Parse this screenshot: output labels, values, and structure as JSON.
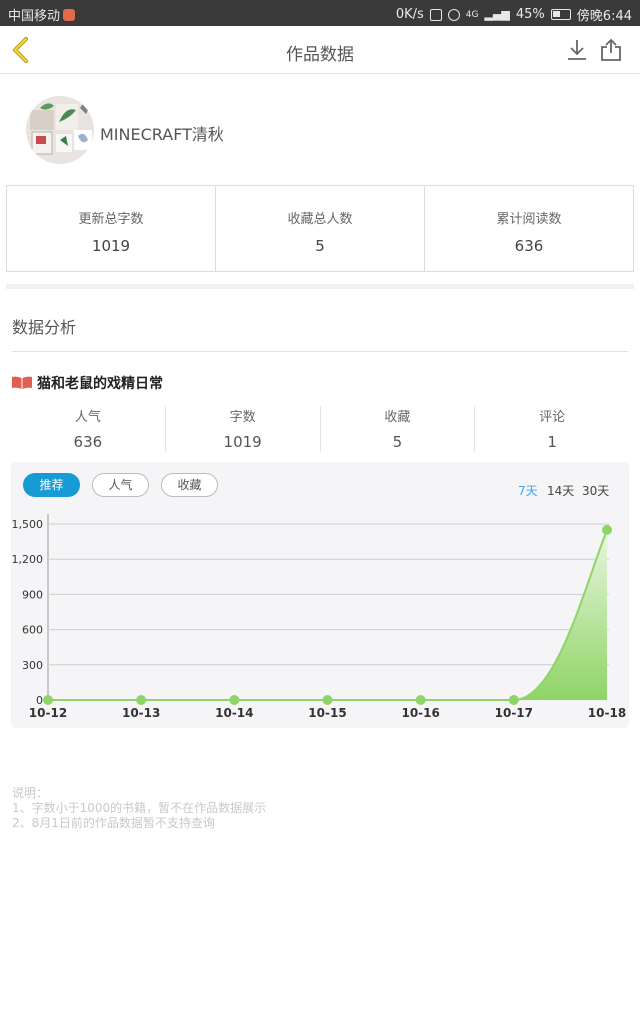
{
  "status_bar": {
    "carrier": "中国移动",
    "speed": "0K/s",
    "network": "4G",
    "battery": "45%",
    "time": "傍晚6:44"
  },
  "header": {
    "title": "作品数据",
    "back_icon": "chevron-left-icon",
    "download_icon": "download-icon",
    "share_icon": "share-icon"
  },
  "profile": {
    "username": "MINECRAFT清秋"
  },
  "summary": [
    {
      "label": "更新总字数",
      "value": "1019"
    },
    {
      "label": "收藏总人数",
      "value": "5"
    },
    {
      "label": "累计阅读数",
      "value": "636"
    }
  ],
  "analysis": {
    "section_title": "数据分析",
    "book_title": "猫和老鼠的戏精日常",
    "stats": [
      {
        "label": "人气",
        "value": "636"
      },
      {
        "label": "字数",
        "value": "1019"
      },
      {
        "label": "收藏",
        "value": "5"
      },
      {
        "label": "评论",
        "value": "1"
      }
    ],
    "tabs": [
      "推荐",
      "人气",
      "收藏"
    ],
    "active_tab": "推荐",
    "ranges": [
      "7天",
      "14天",
      "30天"
    ],
    "active_range": "7天"
  },
  "chart_data": {
    "type": "area",
    "x": [
      "10-12",
      "10-13",
      "10-14",
      "10-15",
      "10-16",
      "10-17",
      "10-18"
    ],
    "series": [
      {
        "values": [
          0,
          0,
          0,
          0,
          0,
          0,
          1450
        ]
      }
    ],
    "ylim": [
      0,
      1500
    ],
    "yticks": [
      0,
      300,
      600,
      900,
      1200,
      1500
    ],
    "ytick_labels": [
      "0",
      "300",
      "600",
      "900",
      "1,200",
      "1,500"
    ],
    "grid": true,
    "line_color": "#8fd466",
    "fill_color": "#8fd466"
  },
  "notes": {
    "heading": "说明：",
    "lines": [
      "1、字数小于1000的书籍，暂不在作品数据展示",
      "2、8月1日前的作品数据暂不支持查询"
    ]
  }
}
